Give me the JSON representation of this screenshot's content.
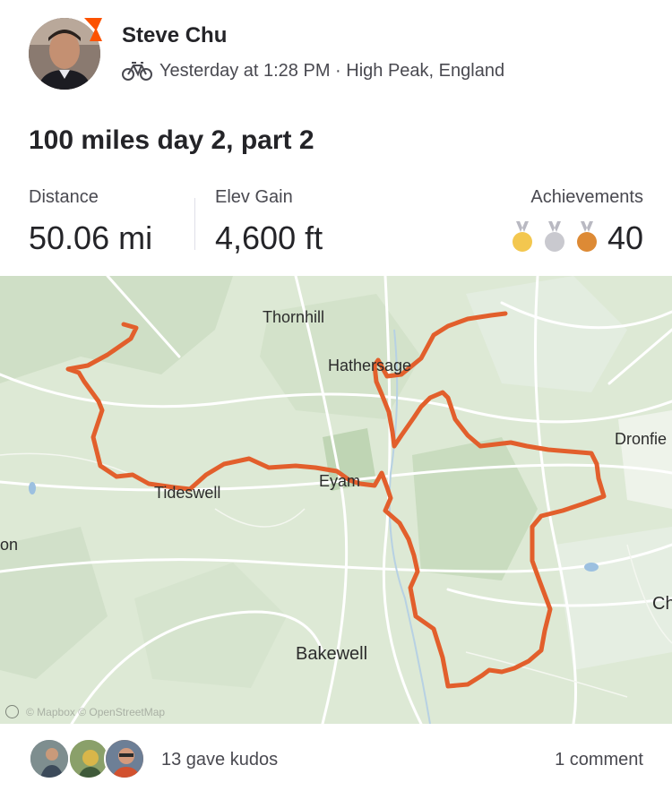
{
  "header": {
    "athlete_name": "Steve Chu",
    "activity_icon": "bike-icon",
    "timestamp": "Yesterday at 1:28 PM",
    "separator": " · ",
    "location": "High Peak, England",
    "brand_badge_color": "#fc5200"
  },
  "activity": {
    "title": "100 miles day 2, part 2"
  },
  "stats": {
    "distance": {
      "label": "Distance",
      "value": "50.06 mi"
    },
    "elevation": {
      "label": "Elev Gain",
      "value": "4,600 ft"
    },
    "achievements": {
      "label": "Achievements",
      "value": "40",
      "medals": [
        {
          "name": "gold-medal-icon",
          "color": "#f3c74f"
        },
        {
          "name": "silver-medal-icon",
          "color": "#c9c9cf"
        },
        {
          "name": "bronze-medal-icon",
          "color": "#dd8a35"
        }
      ]
    }
  },
  "map": {
    "route_color": "#e25f2c",
    "labels": {
      "thornhill": "Thornhill",
      "hathersage": "Hathersage",
      "dronfield": "Dronfie",
      "eyam": "Eyam",
      "tideswell": "Tideswell",
      "left_edge": "on",
      "bakewell": "Bakewell",
      "right_edge": "Ch"
    },
    "attribution": "© Mapbox © OpenStreetMap"
  },
  "social": {
    "kudos_text": "13 gave kudos",
    "comment_text": "1 comment"
  }
}
